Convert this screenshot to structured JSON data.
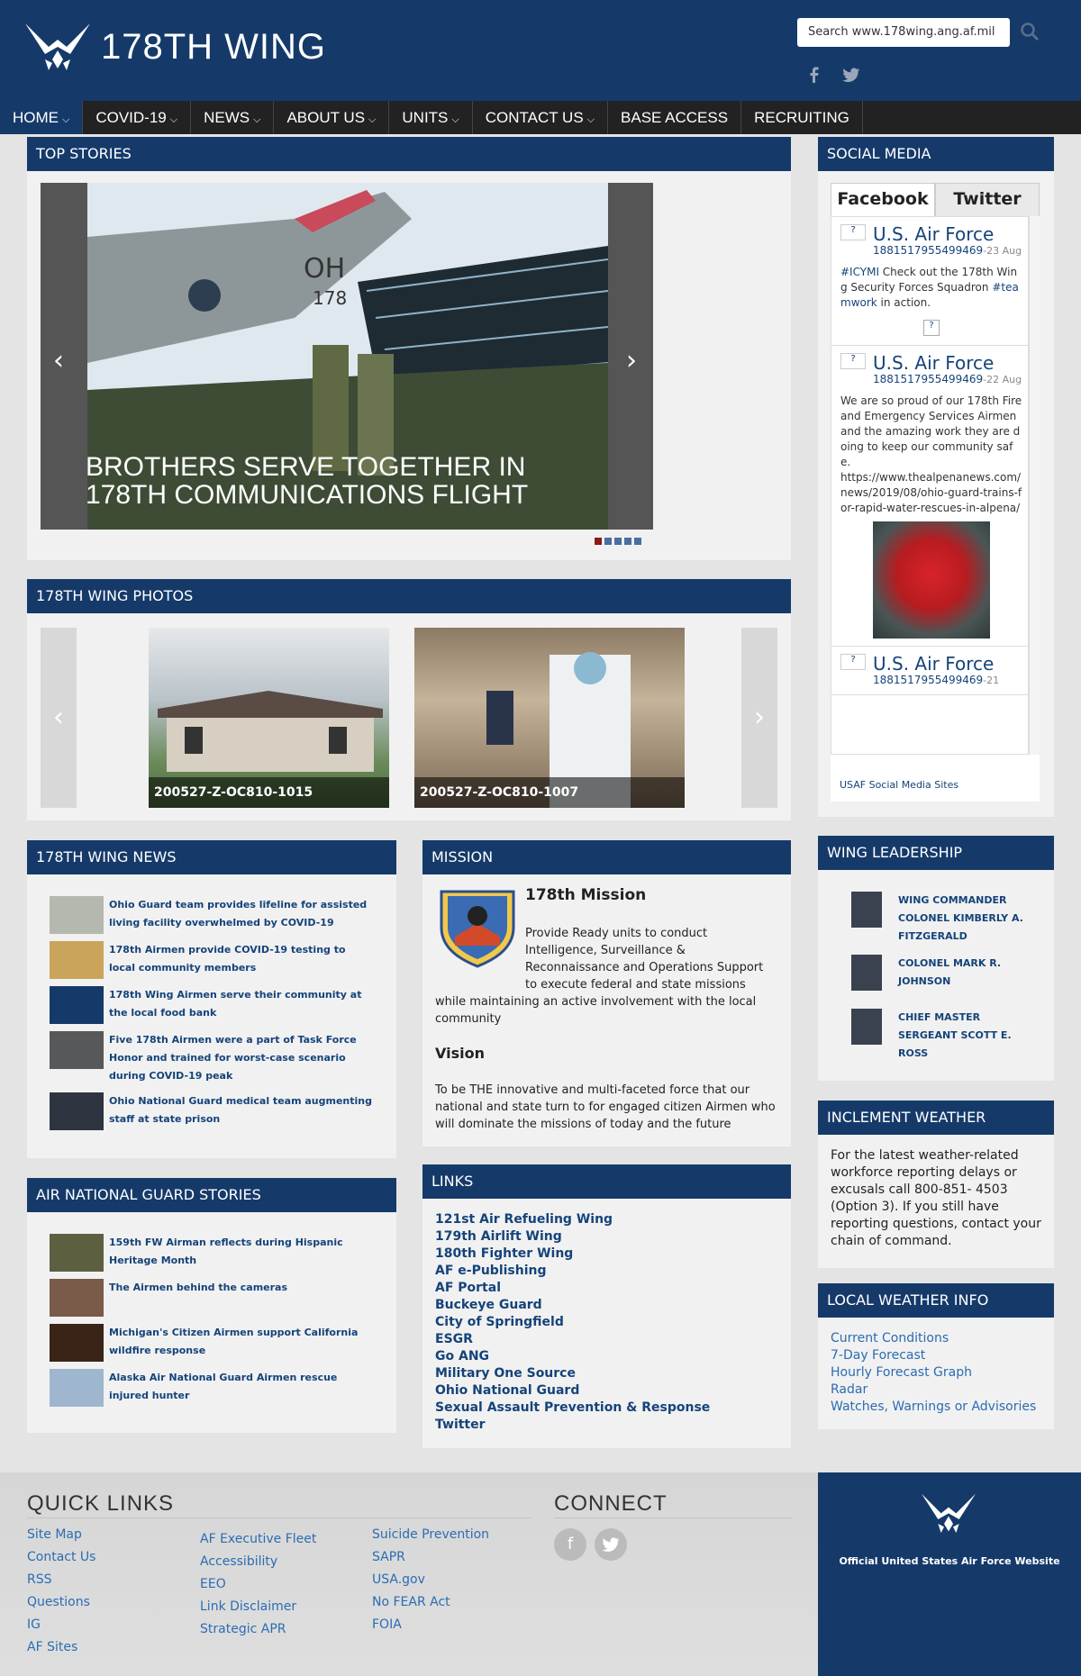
{
  "header": {
    "site_title": "178TH WING",
    "search_placeholder": "Search www.178wing.ang.af.mil"
  },
  "nav": [
    "HOME",
    "COVID-19",
    "NEWS",
    "ABOUT US",
    "UNITS",
    "CONTACT US",
    "BASE ACCESS",
    "RECRUITING"
  ],
  "top_stories": {
    "title": "TOP STORIES",
    "headline": "BROTHERS SERVE TOGETHER IN 178TH COMMUNICATIONS FLIGHT"
  },
  "photos": {
    "title": "178TH WING PHOTOS",
    "items": [
      "200527-Z-OC810-1015",
      "200527-Z-OC810-1007"
    ]
  },
  "wing_news": {
    "title": "178TH WING NEWS",
    "items": [
      "Ohio Guard team provides lifeline for assisted living facility overwhelmed by COVID-19",
      "178th Airmen provide COVID-19 testing to local community members",
      "178th Wing Airmen serve their community at the local food bank",
      "Five 178th Airmen were a part of Task Force Honor and trained for worst-case scenario during COVID-19 peak",
      "Ohio National Guard medical team augmenting staff at state prison"
    ]
  },
  "ang_stories": {
    "title": "AIR NATIONAL GUARD STORIES",
    "items": [
      "159th FW Airman reflects during Hispanic Heritage Month",
      "The Airmen behind the cameras",
      "Michigan's Citizen Airmen support California wildfire response",
      "Alaska Air National Guard Airmen rescue injured hunter"
    ]
  },
  "mission": {
    "title": "MISSION",
    "heading": "178th Mission",
    "text": "Provide Ready units to conduct Intelligence, Surveillance & Reconnaissance and Operations Support to execute federal and state missions while maintaining an active involvement with the local community",
    "vision_heading": "Vision",
    "vision_text": "To be THE innovative and multi-faceted force that our national and state turn to for engaged citizen Airmen who will dominate the missions of today and the future"
  },
  "links": {
    "title": "LINKS",
    "items": [
      "121st Air Refueling Wing",
      "179th Airlift Wing",
      "180th Fighter Wing",
      "AF e-Publishing",
      "AF Portal",
      "Buckeye Guard",
      "City of Springfield",
      "ESGR",
      "Go ANG",
      "Military One Source",
      "Ohio National Guard",
      "Sexual Assault Prevention & Response",
      "Twitter"
    ]
  },
  "social": {
    "title": "SOCIAL MEDIA",
    "tabs": [
      "Facebook",
      "Twitter"
    ],
    "posts": [
      {
        "name": "U.S. Air Force",
        "id": "1881517955499469",
        "date": "-23 Aug",
        "hashtag1": "#ICYMI",
        "body": " Check out the 178th Wing Security Forces Squadron ",
        "hashtag2": "#teamwork",
        "tail": " in action."
      },
      {
        "name": "U.S. Air Force",
        "id": "1881517955499469",
        "date": "-22 Aug",
        "body": "We are so proud of our 178th Fire and Emergency Services Airmen and the amazing work they are doing to keep our community safe.",
        "link": "https://www.thealpenanews.com/news/2019/08/ohio-guard-trains-for-rapid-water-rescues-in-alpena/"
      },
      {
        "name": "U.S. Air Force",
        "id": "1881517955499469",
        "date": "-21"
      }
    ],
    "footer_link": "USAF Social Media Sites"
  },
  "leadership": {
    "title": "WING LEADERSHIP",
    "items": [
      "WING COMMANDER COLONEL KIMBERLY A. FITZGERALD",
      "COLONEL MARK R. JOHNSON",
      "CHIEF MASTER SERGEANT SCOTT E. ROSS"
    ]
  },
  "weather": {
    "title": "INCLEMENT WEATHER",
    "text": "For the latest weather-related workforce reporting delays or excusals call 800-851- 4503 (Option 3).  If you still have reporting questions, contact your chain of command."
  },
  "local_weather": {
    "title": "LOCAL WEATHER INFO",
    "items": [
      "Current Conditions",
      "7-Day Forecast",
      "Hourly Forecast Graph",
      "Radar",
      "Watches, Warnings or Advisories"
    ]
  },
  "footer": {
    "quick_links_title": "QUICK LINKS",
    "col1": [
      "Site Map",
      "Contact Us",
      "RSS",
      "Questions",
      "IG",
      "AF Sites"
    ],
    "col2": [
      "AF Executive Fleet",
      "Accessibility",
      "EEO",
      "Link Disclaimer",
      "Strategic APR"
    ],
    "col3": [
      "Suicide Prevention",
      "SAPR",
      "USA.gov",
      "No FEAR Act",
      "FOIA"
    ],
    "connect_title": "CONNECT",
    "official": "Official United States Air Force Website"
  }
}
